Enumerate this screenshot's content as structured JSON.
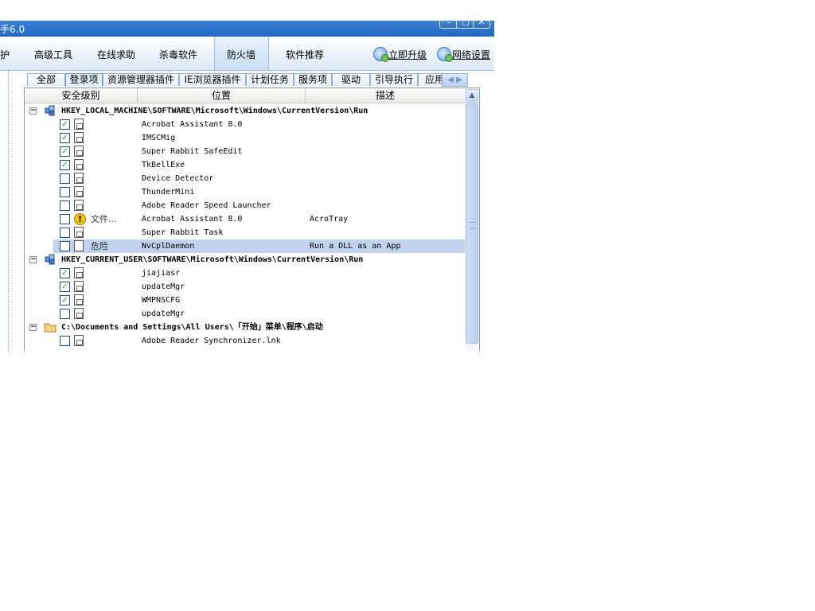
{
  "window": {
    "title": "手6.0",
    "controls": [
      "minimize",
      "maximize",
      "close"
    ]
  },
  "toolbar": {
    "items": [
      {
        "label": "护"
      },
      {
        "label": "高级工具"
      },
      {
        "label": "在线求助"
      },
      {
        "label": "杀毒软件"
      },
      {
        "label": "防火墙"
      },
      {
        "label": "软件推荐"
      }
    ],
    "active": "防火墙",
    "upgrade_label": "立即升级",
    "network_label": "网络设置"
  },
  "subtabs": {
    "items": [
      "全部",
      "登录项",
      "资源管理器插件",
      "IE浏览器插件",
      "计划任务",
      "服务项",
      "驱动",
      "引导执行",
      "应用"
    ],
    "active": "登录项"
  },
  "columns": [
    "安全级别",
    "位置",
    "描述"
  ],
  "groups": [
    {
      "path": "HKEY_LOCAL_MACHINE\\SOFTWARE\\Microsoft\\Windows\\CurrentVersion\\Run",
      "icon": "registry-icon",
      "items": [
        {
          "checked": true,
          "icon": "file-icon",
          "level": "",
          "name": "Acrobat Assistant 8.0",
          "desc": ""
        },
        {
          "checked": true,
          "icon": "file-icon",
          "level": "",
          "name": "IMSCMig",
          "desc": ""
        },
        {
          "checked": true,
          "icon": "file-icon",
          "level": "",
          "name": "Super Rabbit SafeEdit",
          "desc": ""
        },
        {
          "checked": true,
          "icon": "file-icon",
          "level": "",
          "name": "TkBellExe",
          "desc": ""
        },
        {
          "checked": false,
          "icon": "file-icon",
          "level": "",
          "name": "Device Detector",
          "desc": ""
        },
        {
          "checked": false,
          "icon": "file-icon",
          "level": "",
          "name": "ThunderMini",
          "desc": ""
        },
        {
          "checked": false,
          "icon": "file-icon",
          "level": "",
          "name": "Adobe Reader Speed Launcher",
          "desc": ""
        },
        {
          "checked": false,
          "icon": "warning-icon",
          "level": "文件...",
          "name": "Acrobat Assistant 8.0",
          "desc": "AcroTray"
        },
        {
          "checked": false,
          "icon": "file-icon",
          "level": "",
          "name": "Super Rabbit Task",
          "desc": ""
        },
        {
          "checked": false,
          "icon": "blank-file-icon",
          "level": "危险",
          "name": "NvCplDaemon",
          "desc": "Run a DLL as an App",
          "selected": true
        }
      ]
    },
    {
      "path": "HKEY_CURRENT_USER\\SOFTWARE\\Microsoft\\Windows\\CurrentVersion\\Run",
      "icon": "registry-icon",
      "items": [
        {
          "checked": true,
          "icon": "file-icon",
          "level": "",
          "name": "jiajiasr",
          "desc": ""
        },
        {
          "checked": true,
          "icon": "file-icon",
          "level": "",
          "name": "updateMgr",
          "desc": ""
        },
        {
          "checked": true,
          "icon": "file-icon",
          "level": "",
          "name": "WMPNSCFG",
          "desc": ""
        },
        {
          "checked": false,
          "icon": "file-icon",
          "level": "",
          "name": "updateMgr",
          "desc": ""
        }
      ]
    },
    {
      "path": "C:\\Documents and Settings\\All Users\\「开始」菜单\\程序\\启动",
      "icon": "folder-icon",
      "items": [
        {
          "checked": false,
          "icon": "file-icon",
          "level": "",
          "name": "Adobe Reader Synchronizer.lnk",
          "desc": ""
        }
      ]
    }
  ]
}
